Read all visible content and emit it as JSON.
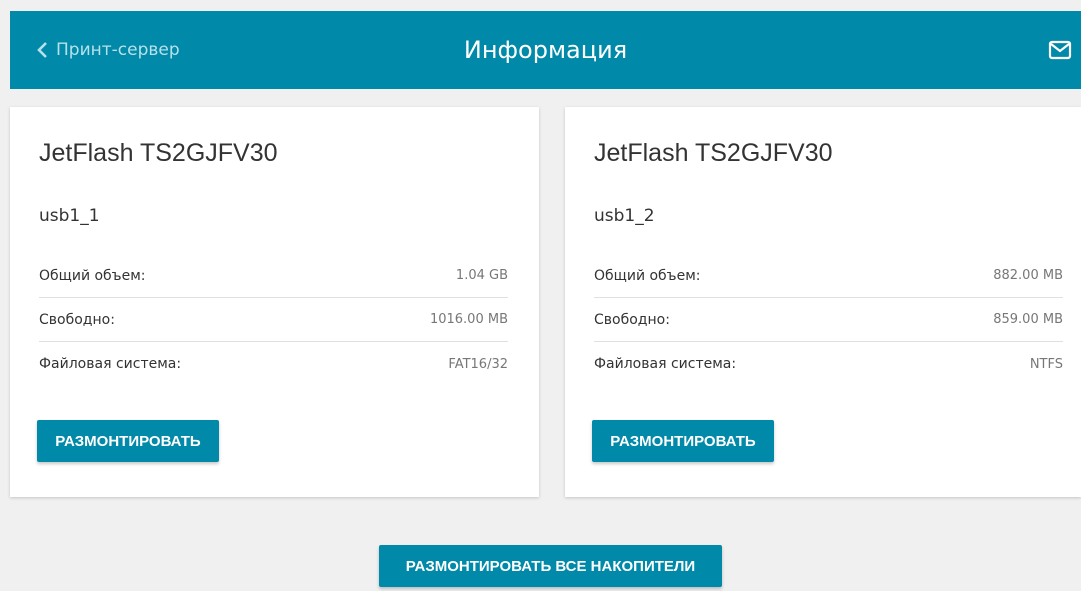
{
  "header": {
    "back_label": "Принт-сервер",
    "title": "Информация",
    "mail_icon": "mail-icon",
    "back_icon": "chevron-left-icon"
  },
  "colors": {
    "accent": "#0089a8",
    "background": "#f0f0f0",
    "card": "#ffffff"
  },
  "drives": [
    {
      "model": "JetFlash TS2GJFV30",
      "partition": "usb1_1",
      "rows": [
        {
          "label": "Общий объем:",
          "value": "1.04 GB"
        },
        {
          "label": "Свободно:",
          "value": "1016.00 MB"
        },
        {
          "label": "Файловая система:",
          "value": "FAT16/32"
        }
      ],
      "button": "РАЗМОНТИРОВАТЬ"
    },
    {
      "model": "JetFlash TS2GJFV30",
      "partition": "usb1_2",
      "rows": [
        {
          "label": "Общий объем:",
          "value": "882.00 MB"
        },
        {
          "label": "Свободно:",
          "value": "859.00 MB"
        },
        {
          "label": "Файловая система:",
          "value": "NTFS"
        }
      ],
      "button": "РАЗМОНТИРОВАТЬ"
    }
  ],
  "footer": {
    "unmount_all_label": "РАЗМОНТИРОВАТЬ ВСЕ НАКОПИТЕЛИ"
  }
}
